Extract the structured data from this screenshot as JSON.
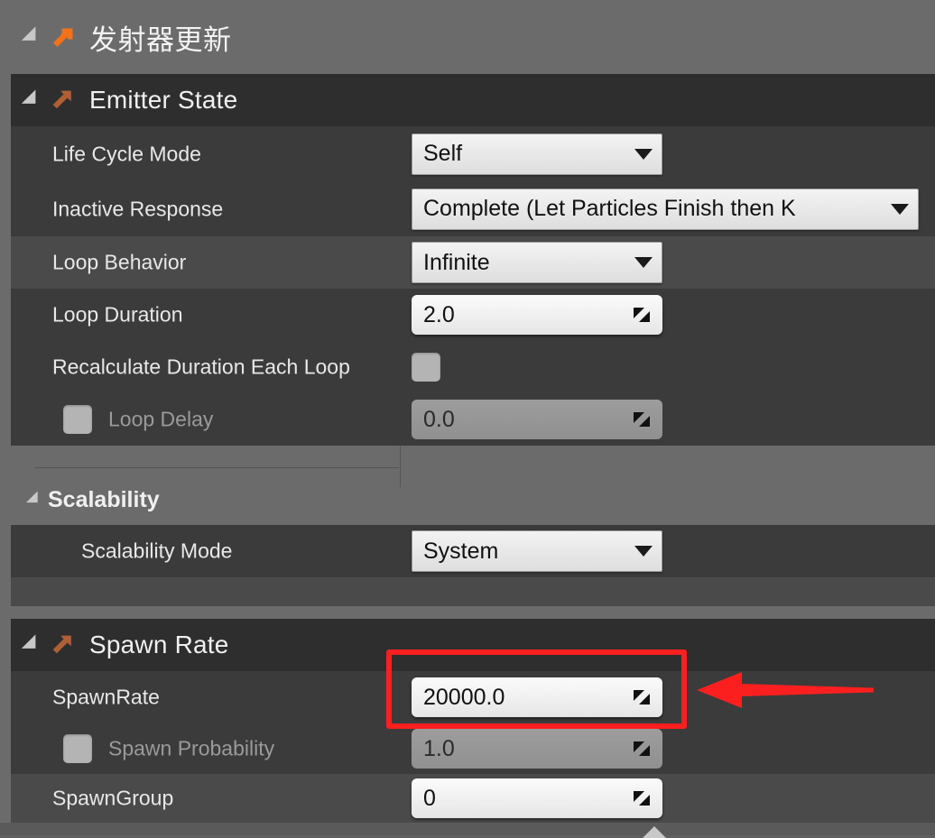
{
  "panel": {
    "module_header": {
      "title": "发射器更新",
      "expander_icon": "triangle-expanded-icon",
      "module_icon": "niagara-module-arrow-icon",
      "icon_color": "#f4711a"
    },
    "colors": {
      "panel_bg": "#6b6b6b",
      "group_header_bg": "#2e2e2e",
      "row_dark": "#3b3b3b",
      "row_light": "#4a4a4a",
      "text": "#e8e8e8",
      "text_dim": "#9a9a9a",
      "module_icon_muted": "#b05f35",
      "annotation_red": "#fb1f1f"
    }
  },
  "sections": [
    {
      "id": "emitter-state",
      "header": {
        "title": "Emitter State",
        "expander_icon": "triangle-expanded-icon",
        "module_icon": "niagara-module-arrow-icon"
      },
      "rows": [
        {
          "id": "life-cycle-mode",
          "label": "Life Cycle Mode",
          "control": "combo",
          "value": "Self",
          "enabled": true,
          "has_checkbox": false
        },
        {
          "id": "inactive-response",
          "label": "Inactive Response",
          "control": "combo",
          "value": "Complete (Let Particles Finish then K",
          "enabled": true,
          "has_checkbox": false
        },
        {
          "id": "loop-behavior",
          "label": "Loop Behavior",
          "control": "combo",
          "value": "Infinite",
          "enabled": true,
          "has_checkbox": false
        },
        {
          "id": "loop-duration",
          "label": "Loop Duration",
          "control": "number",
          "value": "2.0",
          "enabled": true,
          "has_checkbox": false
        },
        {
          "id": "recalculate-duration-each-loop",
          "label": "Recalculate Duration Each Loop",
          "control": "checkbox",
          "value": "",
          "enabled": true,
          "has_checkbox": false
        },
        {
          "id": "loop-delay",
          "label": "Loop Delay",
          "control": "number",
          "value": "0.0",
          "enabled": false,
          "has_checkbox": true
        }
      ],
      "subsection": {
        "id": "scalability",
        "title": "Scalability",
        "expander_icon": "triangle-expanded-icon",
        "rows": [
          {
            "id": "scalability-mode",
            "label": "Scalability Mode",
            "control": "combo",
            "value": "System",
            "enabled": true,
            "has_checkbox": false
          }
        ]
      }
    },
    {
      "id": "spawn-rate",
      "header": {
        "title": "Spawn Rate",
        "expander_icon": "triangle-expanded-icon",
        "module_icon": "niagara-module-arrow-icon"
      },
      "rows": [
        {
          "id": "spawnrate",
          "label": "SpawnRate",
          "control": "number",
          "value": "20000.0",
          "enabled": true,
          "has_checkbox": false,
          "highlighted": true
        },
        {
          "id": "spawn-probability",
          "label": "Spawn Probability",
          "control": "number",
          "value": "1.0",
          "enabled": false,
          "has_checkbox": true
        },
        {
          "id": "spawngroup",
          "label": "SpawnGroup",
          "control": "number",
          "value": "0",
          "enabled": true,
          "has_checkbox": false
        }
      ]
    }
  ],
  "annotations": {
    "highlight_box": {
      "name": "spawnrate-highlight-box",
      "color": "#fb1f1f",
      "target": "spawnrate-value-field"
    },
    "arrow": {
      "name": "red-pointer-arrow",
      "color": "#fb1f1f",
      "direction": "left",
      "target": "spawnrate-value-field"
    }
  },
  "scroll_indicator": {
    "name": "panel-scroll-nub",
    "icon": "triangle-up-icon"
  }
}
